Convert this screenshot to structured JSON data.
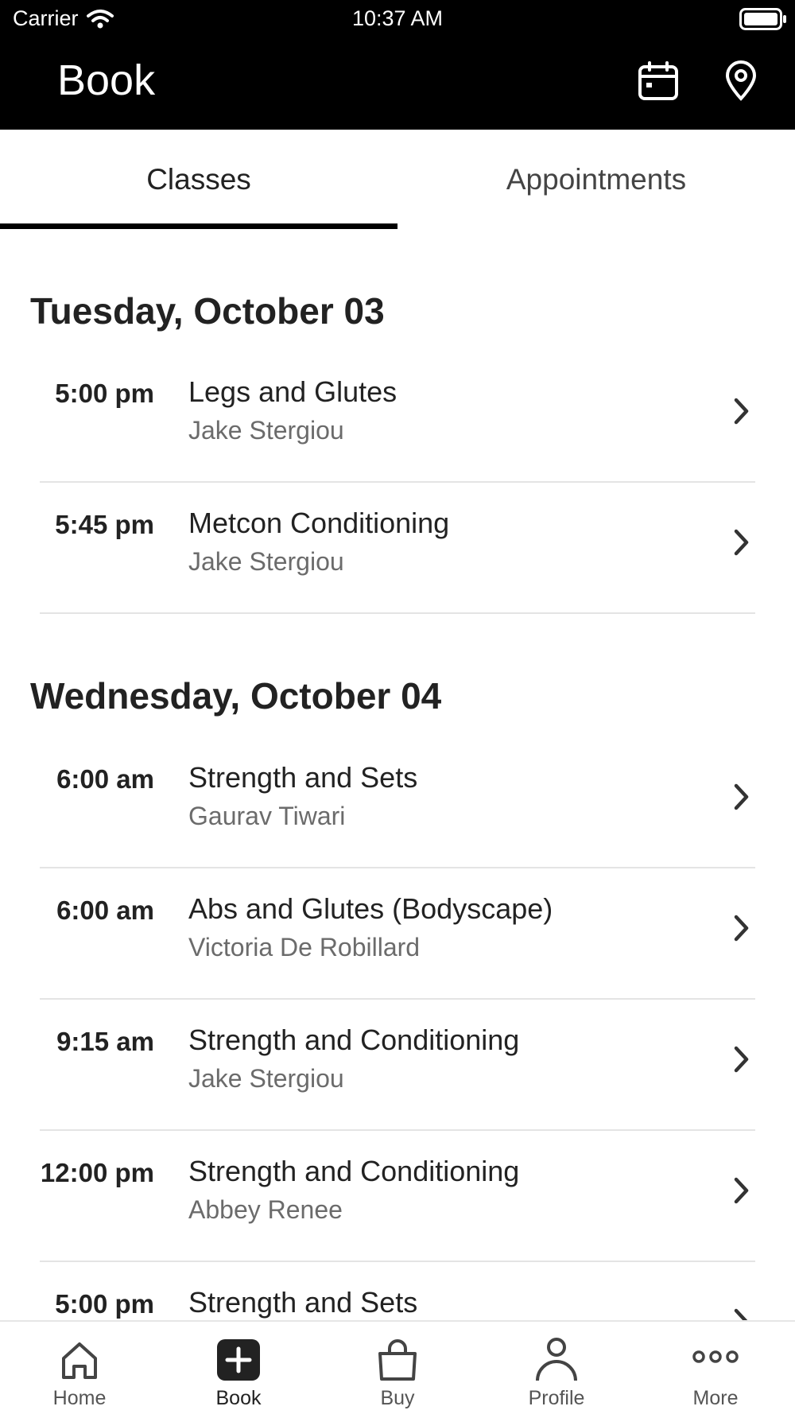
{
  "status_bar": {
    "carrier": "Carrier",
    "time": "10:37 AM"
  },
  "header": {
    "title": "Book"
  },
  "tabs": [
    {
      "label": "Classes",
      "active": true
    },
    {
      "label": "Appointments",
      "active": false
    }
  ],
  "schedule": [
    {
      "day": "Tuesday, October 03",
      "classes": [
        {
          "time": "5:00 pm",
          "name": "Legs and Glutes",
          "instructor": "Jake Stergiou"
        },
        {
          "time": "5:45 pm",
          "name": "Metcon Conditioning",
          "instructor": "Jake Stergiou"
        }
      ]
    },
    {
      "day": "Wednesday, October 04",
      "classes": [
        {
          "time": "6:00 am",
          "name": "Strength and Sets",
          "instructor": "Gaurav Tiwari"
        },
        {
          "time": "6:00 am",
          "name": "Abs and Glutes (Bodyscape)",
          "instructor": "Victoria De Robillard"
        },
        {
          "time": "9:15 am",
          "name": "Strength and Conditioning",
          "instructor": "Jake Stergiou"
        },
        {
          "time": "12:00 pm",
          "name": "Strength and Conditioning",
          "instructor": "Abbey Renee"
        },
        {
          "time": "5:00 pm",
          "name": "Strength and Sets",
          "instructor": ""
        }
      ]
    }
  ],
  "tab_bar": [
    {
      "label": "Home",
      "icon": "home-icon",
      "active": false
    },
    {
      "label": "Book",
      "icon": "plus-square-icon",
      "active": true
    },
    {
      "label": "Buy",
      "icon": "shopping-bag-icon",
      "active": false
    },
    {
      "label": "Profile",
      "icon": "person-icon",
      "active": false
    },
    {
      "label": "More",
      "icon": "more-dots-icon",
      "active": false
    }
  ],
  "colors": {
    "header_bg": "#000000",
    "text": "#222222",
    "secondary_text": "#6b6b6b",
    "divider": "#e4e4e4"
  }
}
